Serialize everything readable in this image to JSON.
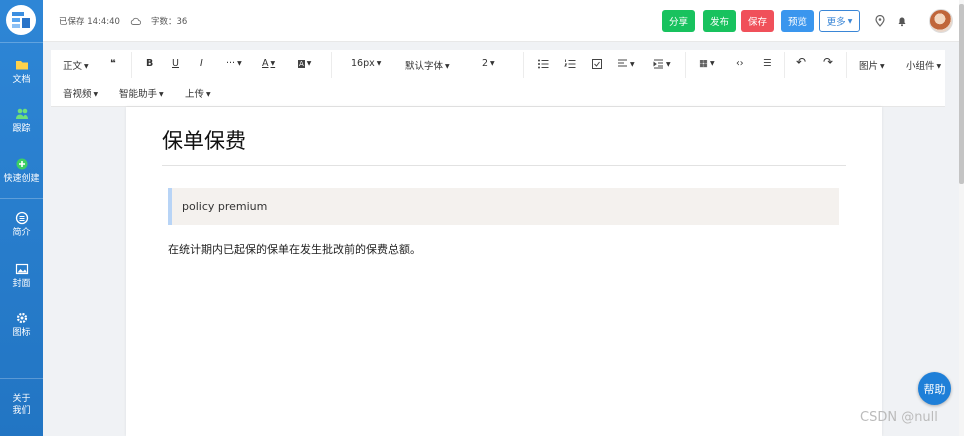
{
  "sidebar": {
    "items": [
      {
        "label": "文档",
        "icon": "folder-icon"
      },
      {
        "label": "跟踪",
        "icon": "users-icon"
      },
      {
        "label": "快速创建",
        "icon": "plus-circle-icon"
      },
      {
        "label": "简介",
        "icon": "list-circle-icon"
      },
      {
        "label": "封面",
        "icon": "image-icon"
      },
      {
        "label": "图标",
        "icon": "gear-icon"
      }
    ],
    "about_line1": "关于",
    "about_line2": "我们"
  },
  "header": {
    "saved_status": "已保存 14:4:40",
    "word_count": "字数：36",
    "share_label": "分享",
    "publish_label": "发布",
    "save_label": "保存",
    "preview_label": "预览",
    "more_label": "更多",
    "colors": {
      "share": "#18c25e",
      "publish": "#18c25e",
      "save": "#f0505a",
      "preview": "#3a96ee"
    }
  },
  "toolbar": {
    "paragraph": "正文",
    "quote": "❝",
    "bold": "B",
    "underline": "U",
    "italic": "I",
    "more_fmt": "···",
    "font_color": "A",
    "bg_color": "A",
    "font_size": "16px",
    "font_family": "默认字体",
    "line_height": "2",
    "table": "▦",
    "code": "‹›",
    "hr": "☰",
    "undo": "↶",
    "redo": "↷",
    "image": "图片",
    "widget": "小组件",
    "media": "音视频",
    "ai": "智能助手",
    "upload": "上传"
  },
  "document": {
    "title": "保单保费",
    "quote": "policy premium",
    "paragraph": "在统计期内已起保的保单在发生批改前的保费总额。"
  },
  "help_label": "帮助",
  "watermark": "CSDN @null"
}
